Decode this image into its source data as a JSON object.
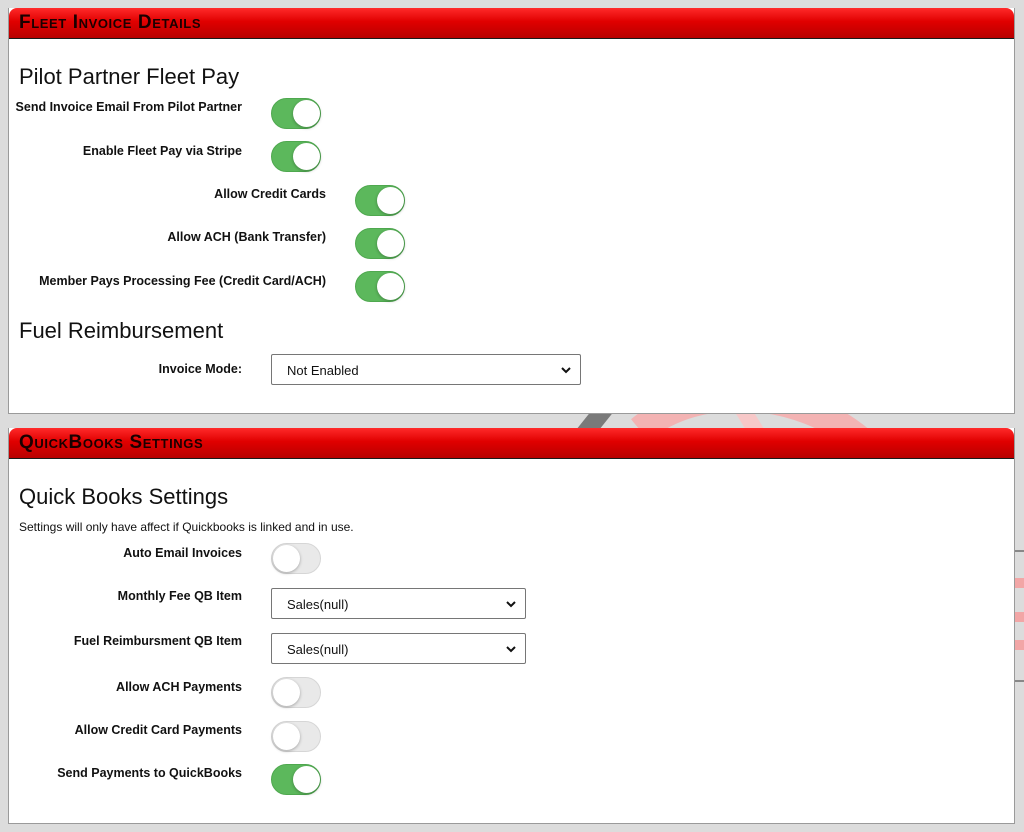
{
  "fleet_invoice": {
    "header": "Fleet Invoice Details",
    "pilot_partner_title": "Pilot Partner Fleet Pay",
    "toggles": [
      {
        "label": "Send Invoice Email From Pilot Partner",
        "on": true
      },
      {
        "label": "Enable Fleet Pay via Stripe",
        "on": true
      },
      {
        "label": "Allow Credit Cards",
        "on": true
      },
      {
        "label": "Allow ACH (Bank Transfer)",
        "on": true
      },
      {
        "label": "Member Pays Processing Fee (Credit Card/ACH)",
        "on": true
      }
    ],
    "fuel_title": "Fuel Reimbursement",
    "invoice_mode_label": "Invoice Mode:",
    "invoice_mode_value": "Not Enabled"
  },
  "quickbooks": {
    "header": "QuickBooks Settings",
    "title": "Quick Books Settings",
    "note": "Settings will only have affect if Quickbooks is linked and in use.",
    "auto_email_label": "Auto Email Invoices",
    "auto_email_on": false,
    "monthly_fee_label": "Monthly Fee QB Item",
    "monthly_fee_value": "Sales(null)",
    "fuel_item_label": "Fuel Reimbursment QB Item",
    "fuel_item_value": "Sales(null)",
    "allow_ach_label": "Allow ACH Payments",
    "allow_ach_on": false,
    "allow_cc_label": "Allow Credit Card Payments",
    "allow_cc_on": false,
    "send_payments_label": "Send Payments to QuickBooks",
    "send_payments_on": true
  },
  "colors": {
    "header_red": "#e00000",
    "toggle_on": "#5cb85c",
    "toggle_off": "#e9e9e9",
    "page_bg": "#dcdcdc"
  },
  "icons": {
    "select_arrow": "chevron-down-icon"
  }
}
